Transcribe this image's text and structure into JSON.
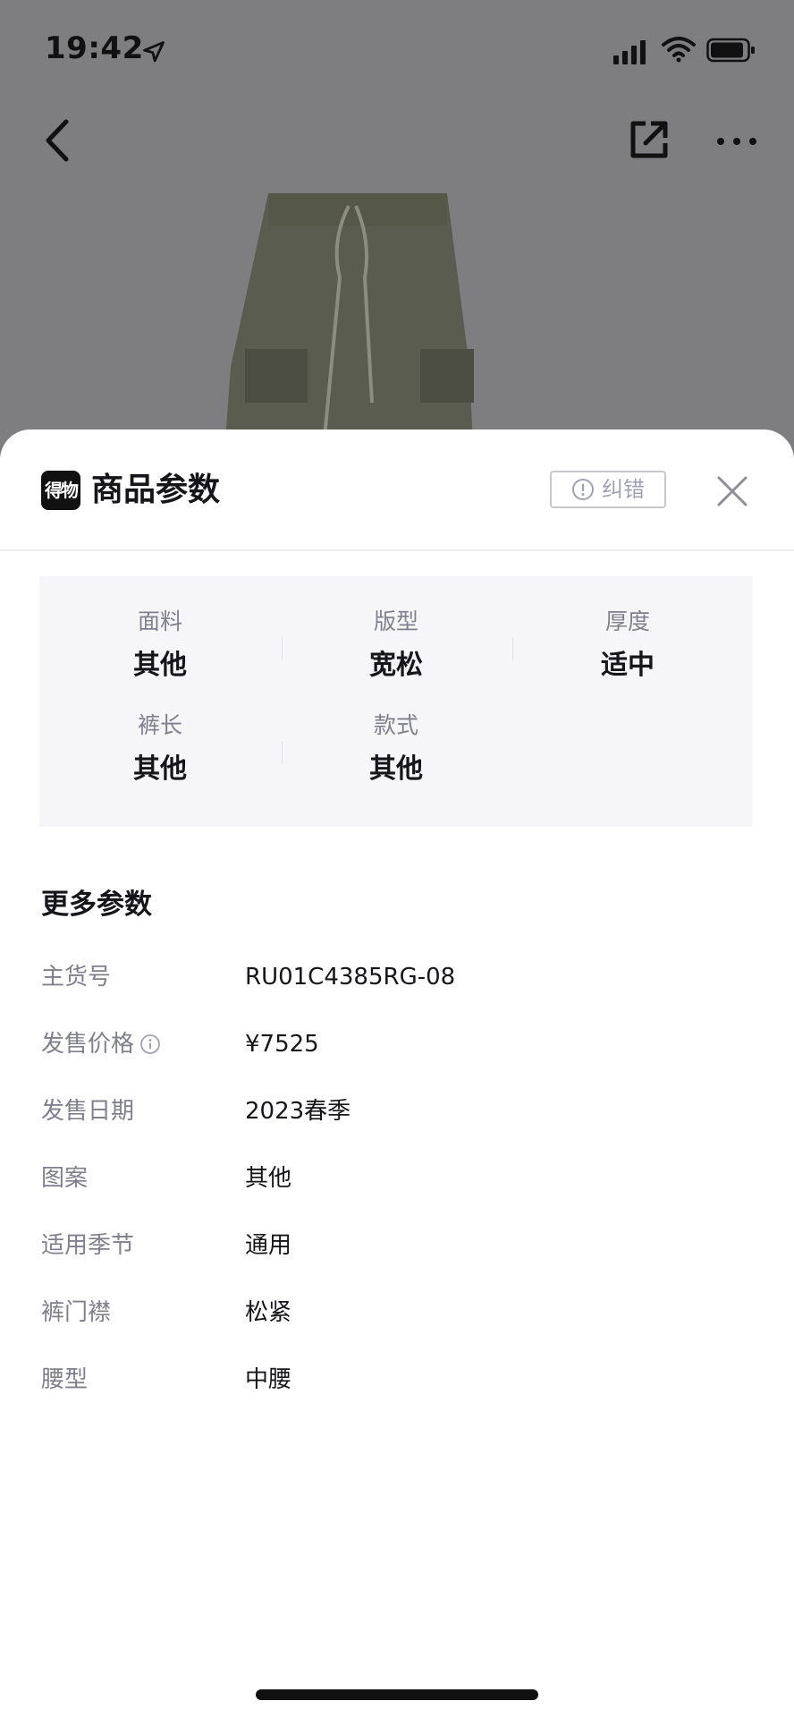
{
  "status_bar": {
    "time": "19:42"
  },
  "sheet": {
    "brand_logo_text": "得物",
    "title": "商品参数",
    "report_label": "纠错"
  },
  "key_params": [
    {
      "label": "面料",
      "value": "其他"
    },
    {
      "label": "版型",
      "value": "宽松"
    },
    {
      "label": "厚度",
      "value": "适中"
    },
    {
      "label": "裤长",
      "value": "其他"
    },
    {
      "label": "款式",
      "value": "其他"
    }
  ],
  "more_params": {
    "title": "更多参数",
    "rows": [
      {
        "label": "主货号",
        "value": "RU01C4385RG-08"
      },
      {
        "label": "发售价格",
        "value": "¥7525",
        "info_icon": "info-icon"
      },
      {
        "label": "发售日期",
        "value": "2023春季"
      },
      {
        "label": "图案",
        "value": "其他"
      },
      {
        "label": "适用季节",
        "value": "通用"
      },
      {
        "label": "裤门襟",
        "value": "松紧"
      },
      {
        "label": "腰型",
        "value": "中腰"
      }
    ]
  },
  "icons": {
    "back": "chevron-left-icon",
    "share": "share-icon",
    "more": "more-icon",
    "close": "close-icon",
    "report": "alert-circle-icon",
    "location": "location-arrow-icon",
    "signal": "signal-icon",
    "wifi": "wifi-icon",
    "battery": "battery-icon"
  },
  "colors": {
    "overlay": "#7e7e80",
    "sheet_bg": "#ffffff",
    "params_bg": "#f6f6f8",
    "label_gray": "#7f7f8e",
    "text_dark": "#16161a"
  }
}
